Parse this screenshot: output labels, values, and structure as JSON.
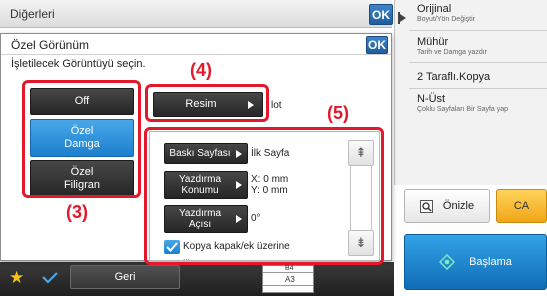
{
  "background": {
    "title": "Diğerleri",
    "ok_label": "OK"
  },
  "right_panel": {
    "items": [
      {
        "title": "Orijinal",
        "subtitle": "Boyut/Yön Değiştir"
      },
      {
        "title": "Mühür",
        "subtitle": "Tarih ve Damga yazdır"
      },
      {
        "title": "2 Taraflı.Kopya",
        "subtitle": ""
      },
      {
        "title": "N-Üst",
        "subtitle": "Çoklu Sayfaları Bir Sayfa yap"
      }
    ],
    "preview_label": "Önizle",
    "ca_label": "CA",
    "start_label": "Başlama"
  },
  "dialog": {
    "title": "Özel Görünüm",
    "ok_label": "OK",
    "instruction": "İşletilecek Görüntüyü seçin.",
    "options": [
      {
        "label": "Off",
        "selected": false
      },
      {
        "label": "Özel\nDamga",
        "selected": true
      },
      {
        "label": "Özel\nFiligran",
        "selected": false
      }
    ],
    "resim_label": "Resim",
    "resim_suffix": "lot",
    "settings": [
      {
        "button": "Baskı Sayfası",
        "value": "İlk Sayfa"
      },
      {
        "button": "Yazdırma\nKonumu",
        "value": "X: 0 mm\nY: 0 mm"
      },
      {
        "button": "Yazdırma\nAçısı",
        "value": "0°"
      }
    ],
    "checkbox_label": "Kopya kapak/ek üzerine",
    "checkbox_label_cont": "...",
    "scroll_up": "⇞",
    "scroll_down": "⇟"
  },
  "callouts": {
    "c3": "(3)",
    "c4": "(4)",
    "c5": "(5)"
  },
  "bottom_bar": {
    "back_label": "Geri",
    "paper_sizes": [
      "B4",
      "A3"
    ]
  },
  "colors": {
    "accent_blue": "#1c7fcc",
    "callout_red": "#e3192b",
    "ok_blue": "#2a6fb4",
    "ca_orange": "#f1a516",
    "start_blue": "#1a85cf"
  }
}
